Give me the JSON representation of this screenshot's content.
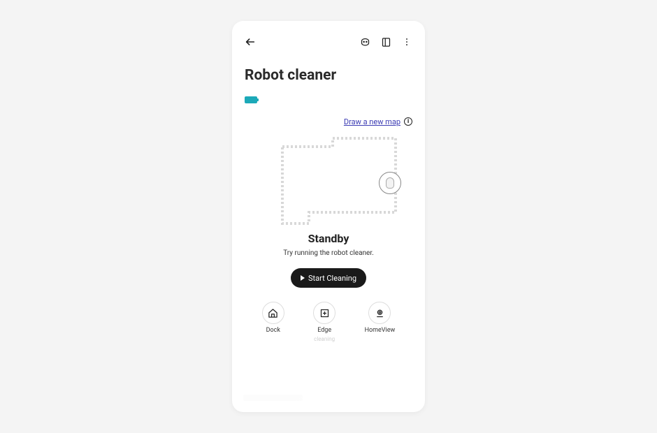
{
  "header": {
    "title": "Robot cleaner"
  },
  "topbar": {
    "back_icon": "back-arrow-icon",
    "robot_icon": "robot-head-icon",
    "panel_icon": "panel-icon",
    "more_icon": "more-vertical-icon"
  },
  "battery": {
    "level_icon": "battery-full-icon"
  },
  "map": {
    "link_label": "Draw a new map",
    "info_icon": "info-icon"
  },
  "status": {
    "heading": "Standby",
    "sub": "Try running the robot cleaner."
  },
  "start": {
    "label": "Start Cleaning"
  },
  "actions": [
    {
      "key": "dock",
      "label": "Dock",
      "sublabel": "",
      "icon": "home-icon"
    },
    {
      "key": "edge",
      "label": "Edge",
      "sublabel": "cleaning",
      "icon": "edge-icon"
    },
    {
      "key": "homeview",
      "label": "HomeView",
      "sublabel": "",
      "icon": "camera-icon"
    }
  ]
}
